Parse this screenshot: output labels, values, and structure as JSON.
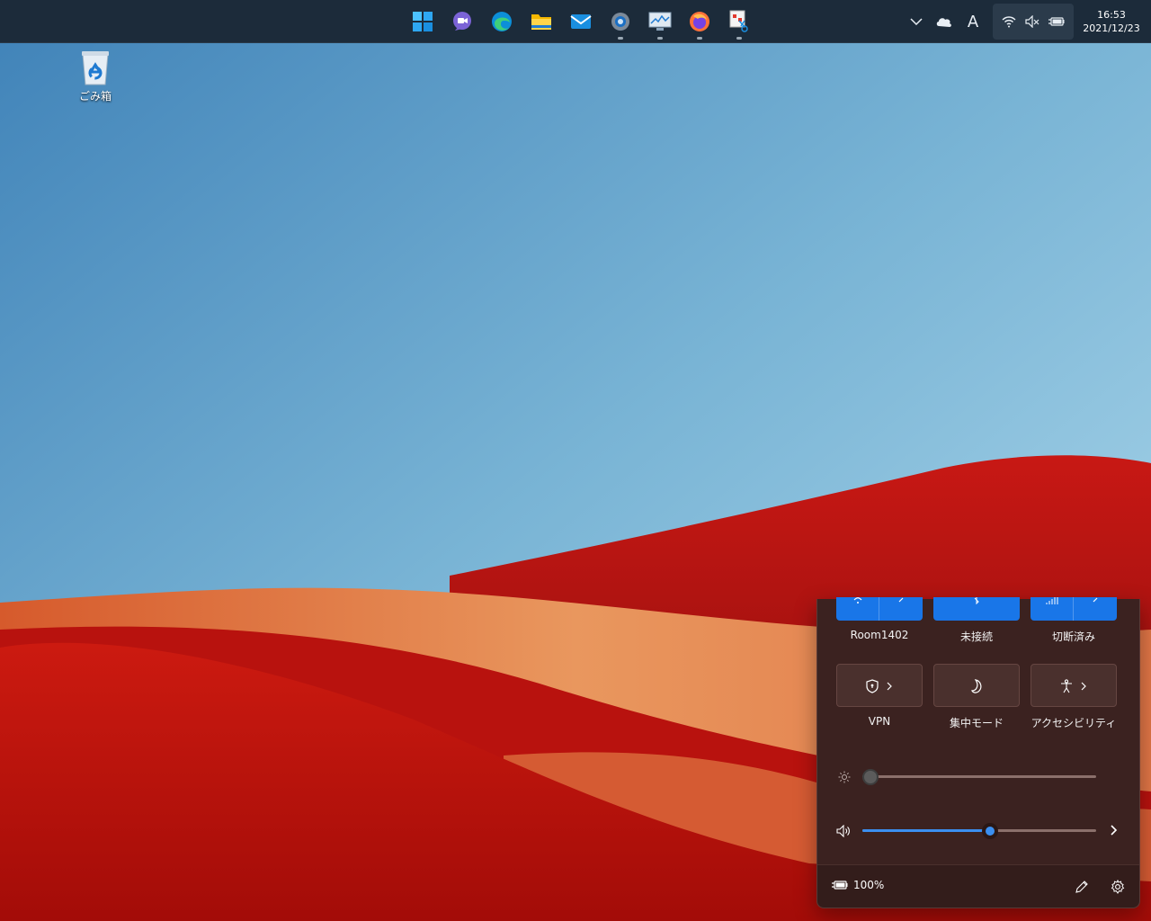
{
  "desktop": {
    "recycle_bin_label": "ごみ箱"
  },
  "taskbar": {
    "pinned": [
      {
        "name": "start-icon"
      },
      {
        "name": "chat-icon"
      },
      {
        "name": "edge-icon"
      },
      {
        "name": "file-explorer-icon"
      },
      {
        "name": "mail-icon"
      },
      {
        "name": "settings-icon"
      },
      {
        "name": "performance-monitor-icon"
      },
      {
        "name": "firefox-icon"
      },
      {
        "name": "snipping-tool-icon"
      }
    ],
    "ime_label": "A",
    "clock_time": "16:53",
    "clock_date": "2021/12/23"
  },
  "quick_settings": {
    "tiles": [
      {
        "label": "Room1402",
        "state": "on",
        "icon": "wifi-icon"
      },
      {
        "label": "未接続",
        "state": "on",
        "icon": "bluetooth-icon"
      },
      {
        "label": "切断済み",
        "state": "on",
        "icon": "cellular-icon"
      },
      {
        "label": "VPN",
        "state": "off",
        "icon": "shield-icon"
      },
      {
        "label": "集中モード",
        "state": "off",
        "icon": "moon-icon"
      },
      {
        "label": "アクセシビリティ",
        "state": "off",
        "icon": "accessibility-icon"
      }
    ],
    "brightness_level": 0,
    "volume_level": 0.55,
    "battery_label": "100%"
  },
  "colors": {
    "accent": "#1976e8",
    "flyout_bg": "#3b2220",
    "taskbar_bg": "#1c2b3a"
  }
}
